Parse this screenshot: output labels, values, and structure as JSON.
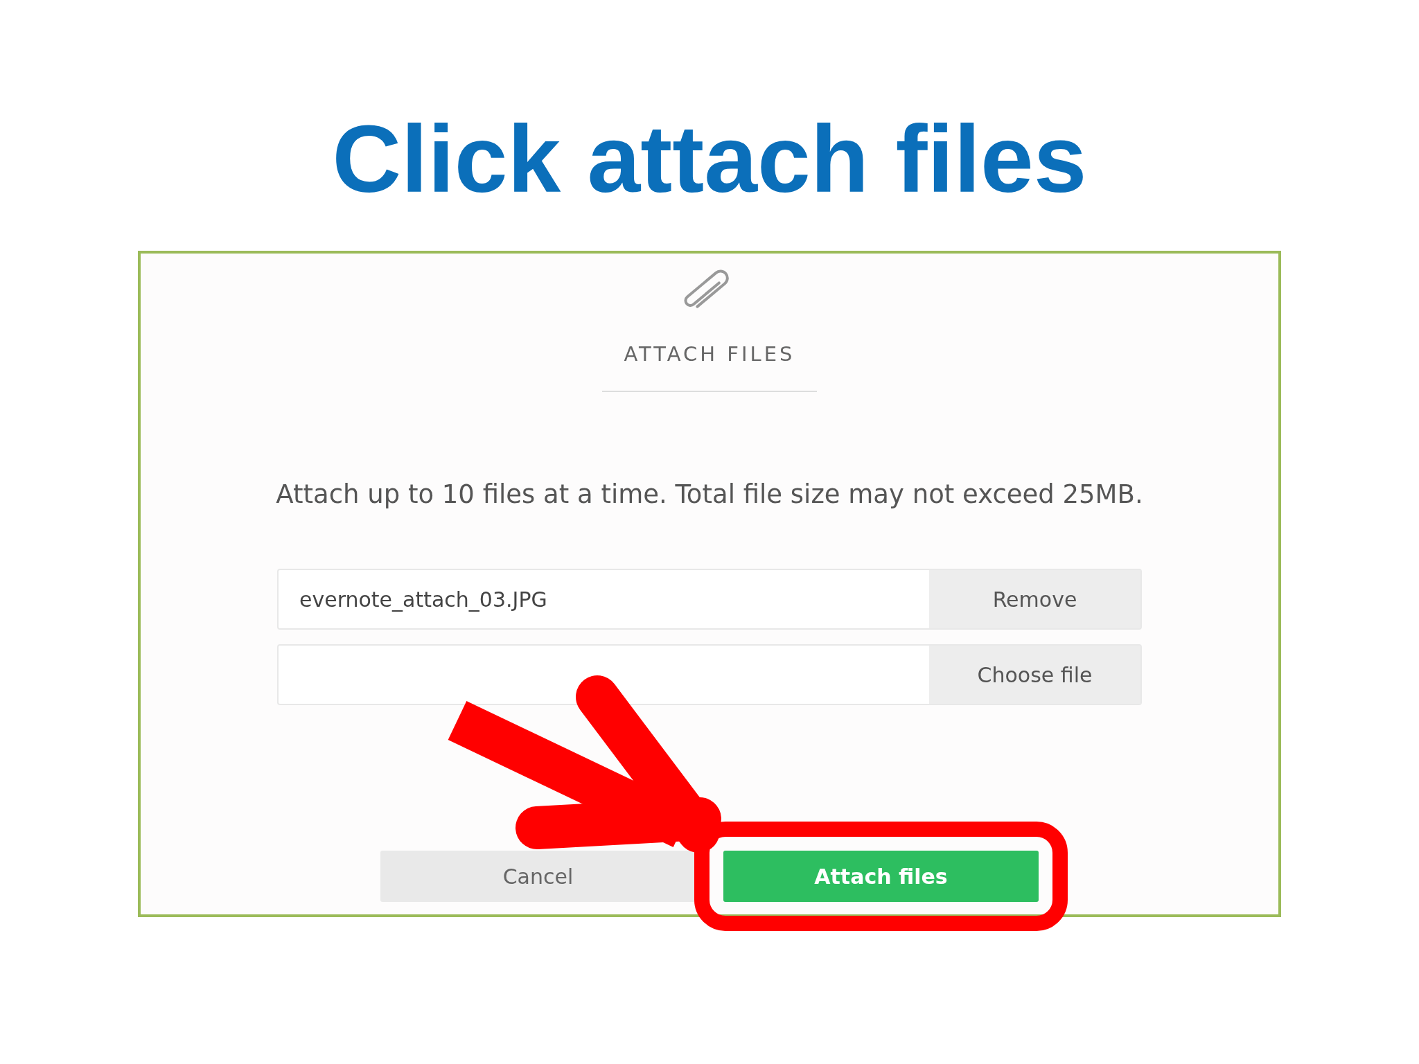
{
  "slide_title": "Click attach files",
  "dialog": {
    "heading": "ATTACH FILES",
    "instruction": "Attach up to 10 files at a time. Total file size may not exceed 25MB.",
    "file_rows": [
      {
        "file_name": "evernote_attach_03.JPG",
        "action": "Remove"
      },
      {
        "action": "Choose file"
      }
    ],
    "buttons": [
      {
        "label": "Cancel",
        "kind": "secondary",
        "highlighted": false
      },
      {
        "label": "Attach files",
        "kind": "primary",
        "highlighted": true
      }
    ]
  }
}
